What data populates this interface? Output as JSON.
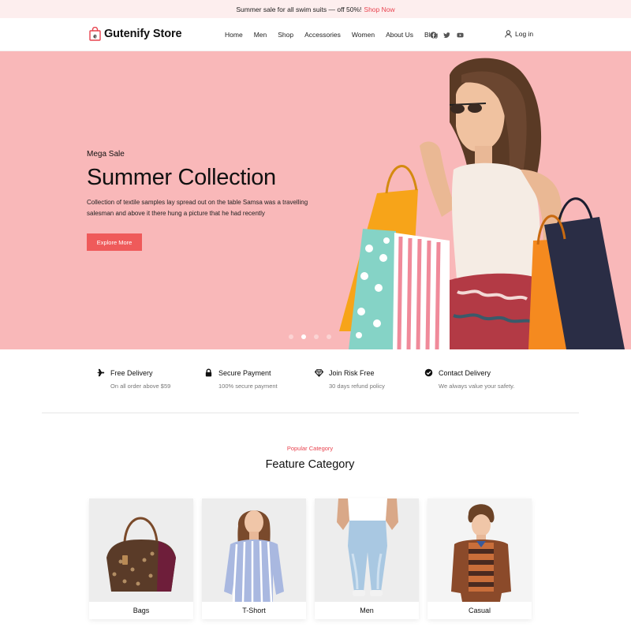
{
  "announcement": {
    "text": "Summer sale for all swim suits — off 50%!",
    "link": "Shop Now"
  },
  "header": {
    "logo": "Gutenify Store",
    "nav": [
      "Home",
      "Men",
      "Shop",
      "Accessories",
      "Women",
      "About Us",
      "Blog"
    ],
    "socials": [
      "facebook-icon",
      "twitter-icon",
      "youtube-icon"
    ],
    "login": "Log in"
  },
  "hero": {
    "eyebrow": "Mega Sale",
    "title": "Summer Collection",
    "description": "Collection of textile samples lay spread out on the table Samsa was a travelling salesman and above it there hung a picture that he had recently",
    "button": "Explore More",
    "slides": 4,
    "active_slide": 2
  },
  "features": [
    {
      "icon": "plane-icon",
      "title": "Free Delivery",
      "subtitle": "On all order above $59"
    },
    {
      "icon": "lock-icon",
      "title": "Secure Payment",
      "subtitle": "100% secure payment"
    },
    {
      "icon": "diamond-icon",
      "title": "Join Risk Free",
      "subtitle": "30 days refund policy"
    },
    {
      "icon": "check-circle-icon",
      "title": "Contact Delivery",
      "subtitle": "We always value your safety."
    }
  ],
  "category": {
    "eyebrow": "Popular Category",
    "title": "Feature Category",
    "items": [
      {
        "label": "Bags"
      },
      {
        "label": "T-Short"
      },
      {
        "label": "Men"
      },
      {
        "label": "Casual"
      }
    ]
  },
  "colors": {
    "accent": "#ef5a5a",
    "hero_bg": "#f9b8b9",
    "topbar_bg": "#fdeeee"
  }
}
